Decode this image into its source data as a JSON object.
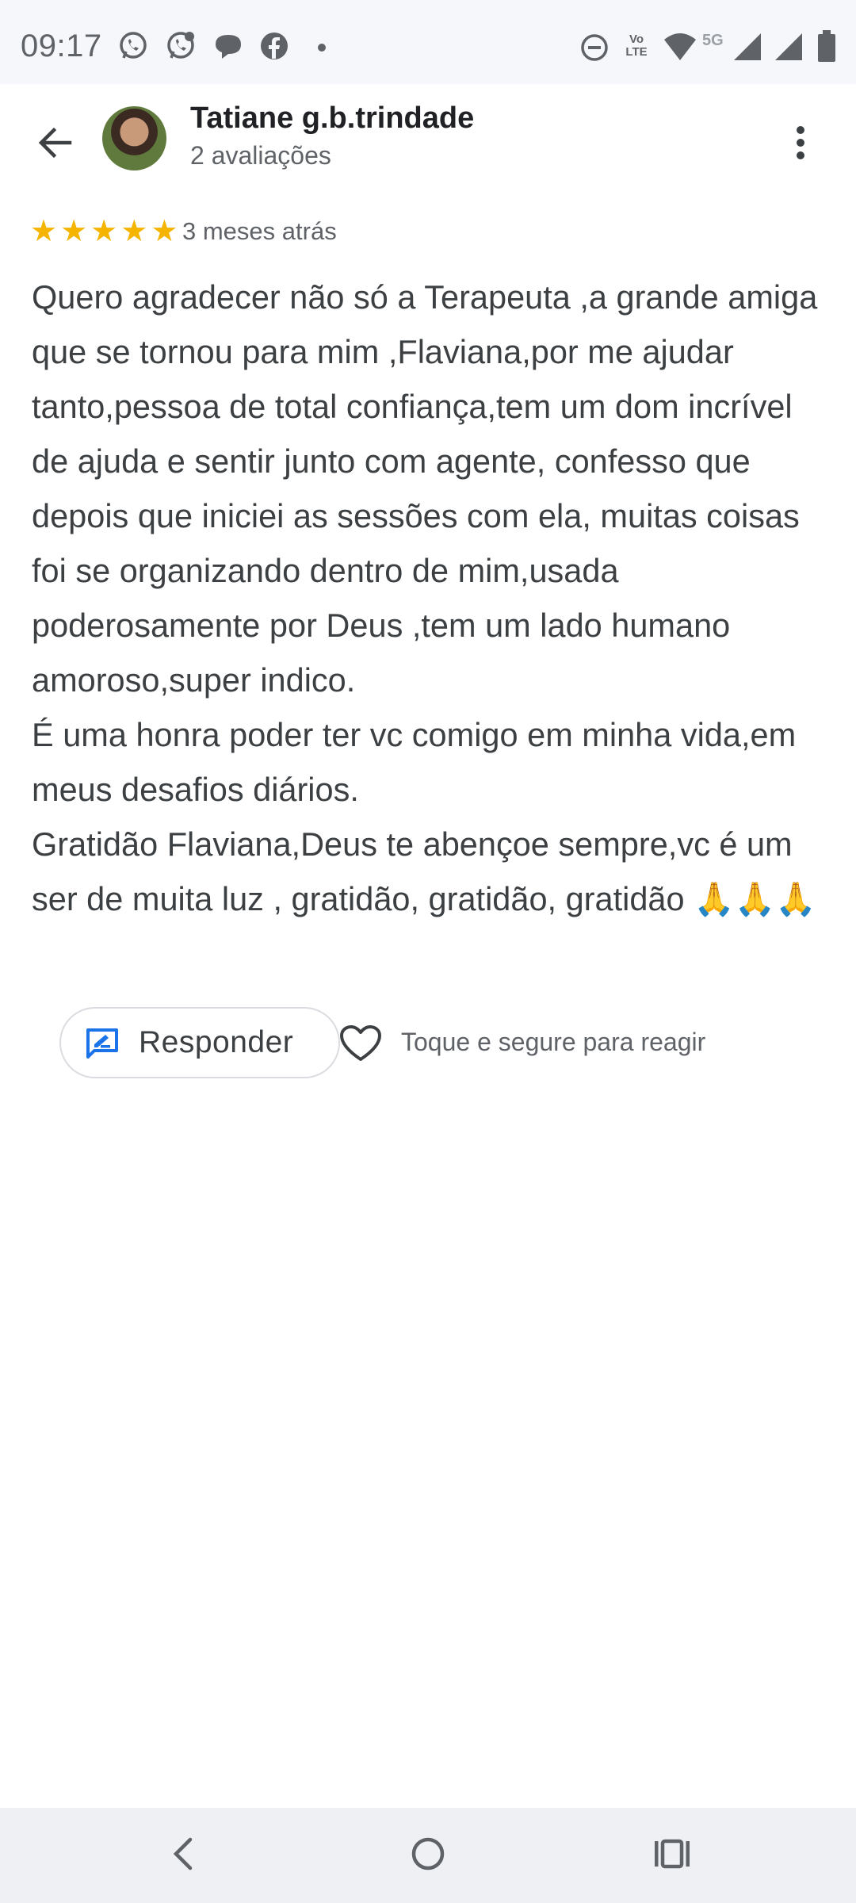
{
  "status_bar": {
    "time": "09:17",
    "notification_icons": [
      "whatsapp-icon",
      "whatsapp-business-icon",
      "chat-bubble-icon",
      "facebook-icon",
      "dot-icon"
    ],
    "system_icons": [
      "do-not-disturb-icon",
      "volte-icon",
      "wifi-icon",
      "5g-icon",
      "signal-icon",
      "signal-icon",
      "battery-icon"
    ],
    "volte_label": "Vo LTE",
    "network_label": "5G"
  },
  "header": {
    "author_name": "Tatiane g.b.trindade",
    "review_count": "2 avaliações"
  },
  "review": {
    "rating": 5,
    "max_rating": 5,
    "stars_color": "#f4b400",
    "date": "3 meses atrás",
    "text": "Quero agradecer não só a Terapeuta ,a grande amiga que se tornou para mim ,Flaviana,por me ajudar tanto,pessoa de total confiança,tem um dom incrível de ajuda e sentir junto com agente, confesso que depois que iniciei as sessões com ela, muitas coisas foi se organizando dentro de mim,usada poderosamente por Deus ,tem um lado humano amoroso,super indico.\nÉ uma honra poder ter vc comigo em minha vida,em meus desafios diários.\nGratidão Flaviana,Deus te abençoe sempre,vc é um ser de muita luz , gratidão, gratidão, gratidão 🙏🙏🙏"
  },
  "actions": {
    "reply_label": "Responder",
    "react_hint": "Toque e segure para reagir",
    "accent_color": "#1a73e8"
  },
  "nav_bar": {
    "items": [
      "back-icon",
      "home-icon",
      "recents-icon"
    ]
  }
}
